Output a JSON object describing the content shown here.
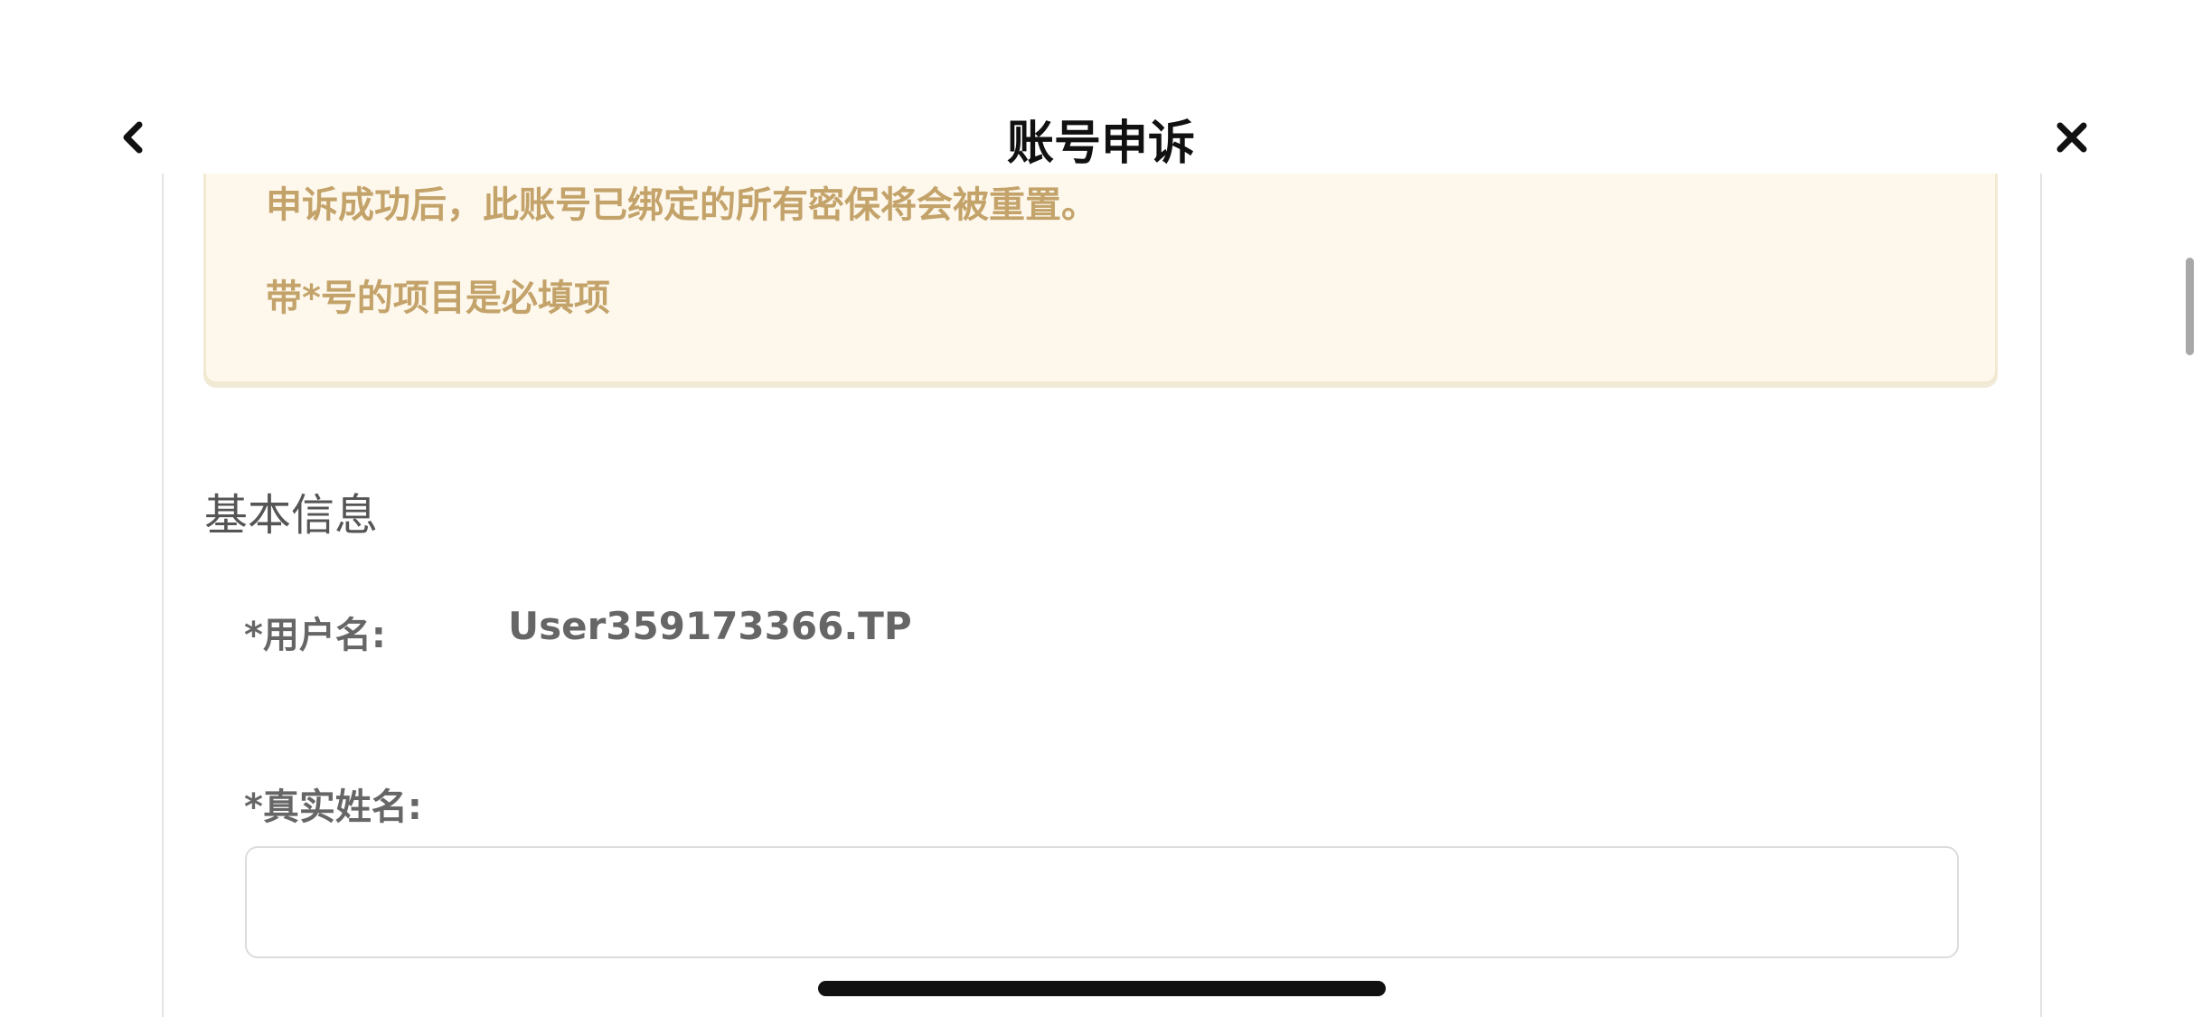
{
  "header": {
    "title": "账号申诉",
    "back_icon": "chevron-left-icon",
    "close_icon": "close-icon"
  },
  "notice": {
    "line1": "申诉成功后，此账号已绑定的所有密保将会被重置。",
    "line2": "带*号的项目是必填项",
    "text_color": "#c3a36a",
    "background_color": "#fdf7ec"
  },
  "basic_info": {
    "section_title": "基本信息",
    "username_label": "*用户名:",
    "username_value": "User359173366.TP",
    "realname_label": "*真实姓名:",
    "realname_value": "",
    "realname_placeholder": ""
  },
  "scroll": {
    "position_fraction": 0.25
  }
}
